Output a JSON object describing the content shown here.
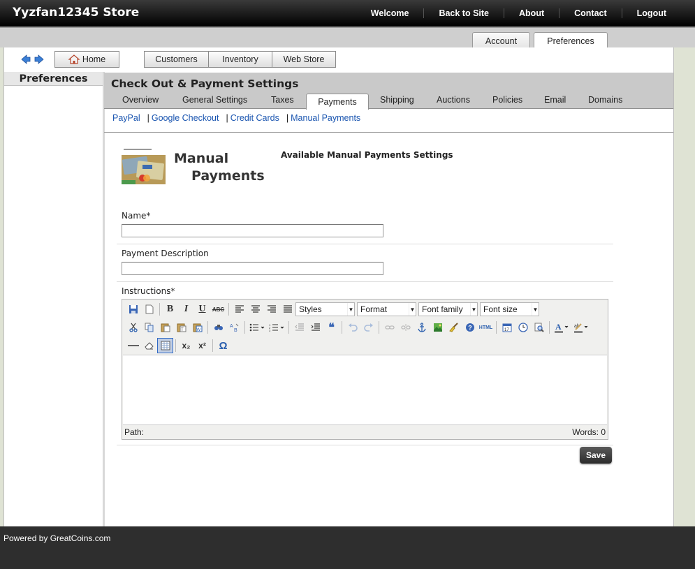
{
  "header": {
    "store_title": "Yyzfan12345 Store",
    "nav": [
      "Welcome",
      "Back to Site",
      "About",
      "Contact",
      "Logout"
    ]
  },
  "account_tabs": {
    "account": "Account",
    "preferences": "Preferences",
    "active": "Preferences"
  },
  "toolbar": {
    "home": "Home",
    "groups": [
      "Customers",
      "Inventory",
      "Web Store"
    ]
  },
  "sidebar": {
    "title": "Preferences"
  },
  "main": {
    "title": "Check Out & Payment Settings",
    "tabs": [
      "Overview",
      "General Settings",
      "Taxes",
      "Payments",
      "Shipping",
      "Auctions",
      "Policies",
      "Email",
      "Domains"
    ],
    "active_tab": "Payments",
    "sublinks": [
      "PayPal",
      "Google Checkout",
      "Credit Cards",
      "Manual Payments"
    ]
  },
  "manual_payments": {
    "title_line1": "Manual",
    "title_line2": "Payments",
    "settings_heading": "Available Manual Payments Settings"
  },
  "form": {
    "name_label": "Name*",
    "name_value": "",
    "description_label": "Payment Description",
    "description_value": "",
    "instructions_label": "Instructions*"
  },
  "editor": {
    "styles": "Styles",
    "format": "Format",
    "font_family": "Font family",
    "font_size": "Font size",
    "path_label": "Path:",
    "word_count": "Words: 0",
    "toolbar_icons": {
      "row1": [
        "save-icon",
        "new-document-icon",
        "bold-icon",
        "italic-icon",
        "underline-icon",
        "strikethrough-icon",
        "align-left-icon",
        "align-center-icon",
        "align-right-icon",
        "align-justify-icon"
      ],
      "row2": [
        "cut-icon",
        "copy-icon",
        "paste-icon",
        "paste-text-icon",
        "paste-word-icon",
        "find-icon",
        "replace-icon",
        "bullet-list-icon",
        "numbered-list-icon",
        "outdent-icon",
        "indent-icon",
        "blockquote-icon",
        "undo-icon",
        "redo-icon",
        "link-icon",
        "unlink-icon",
        "anchor-icon",
        "image-icon",
        "cleanup-icon",
        "help-icon",
        "html-icon",
        "insert-date-icon",
        "insert-time-icon",
        "preview-icon",
        "text-color-icon",
        "highlight-color-icon"
      ],
      "row3": [
        "horizontal-rule-icon",
        "remove-format-icon",
        "visual-aid-icon",
        "subscript-icon",
        "superscript-icon",
        "special-char-icon"
      ]
    },
    "glyphs": {
      "bold": "B",
      "italic": "I",
      "underline": "U",
      "strike": "ABC",
      "html": "HTML",
      "sub": "x₂",
      "sup": "x²",
      "omega": "Ω",
      "quote": "❝",
      "text_color": "A"
    }
  },
  "save_label": "Save",
  "footer": {
    "text": "Powered by GreatCoins.com"
  },
  "colors": {
    "link": "#1a55b0",
    "header_bg": "#111111",
    "footer_bg": "#2e2e2e"
  }
}
